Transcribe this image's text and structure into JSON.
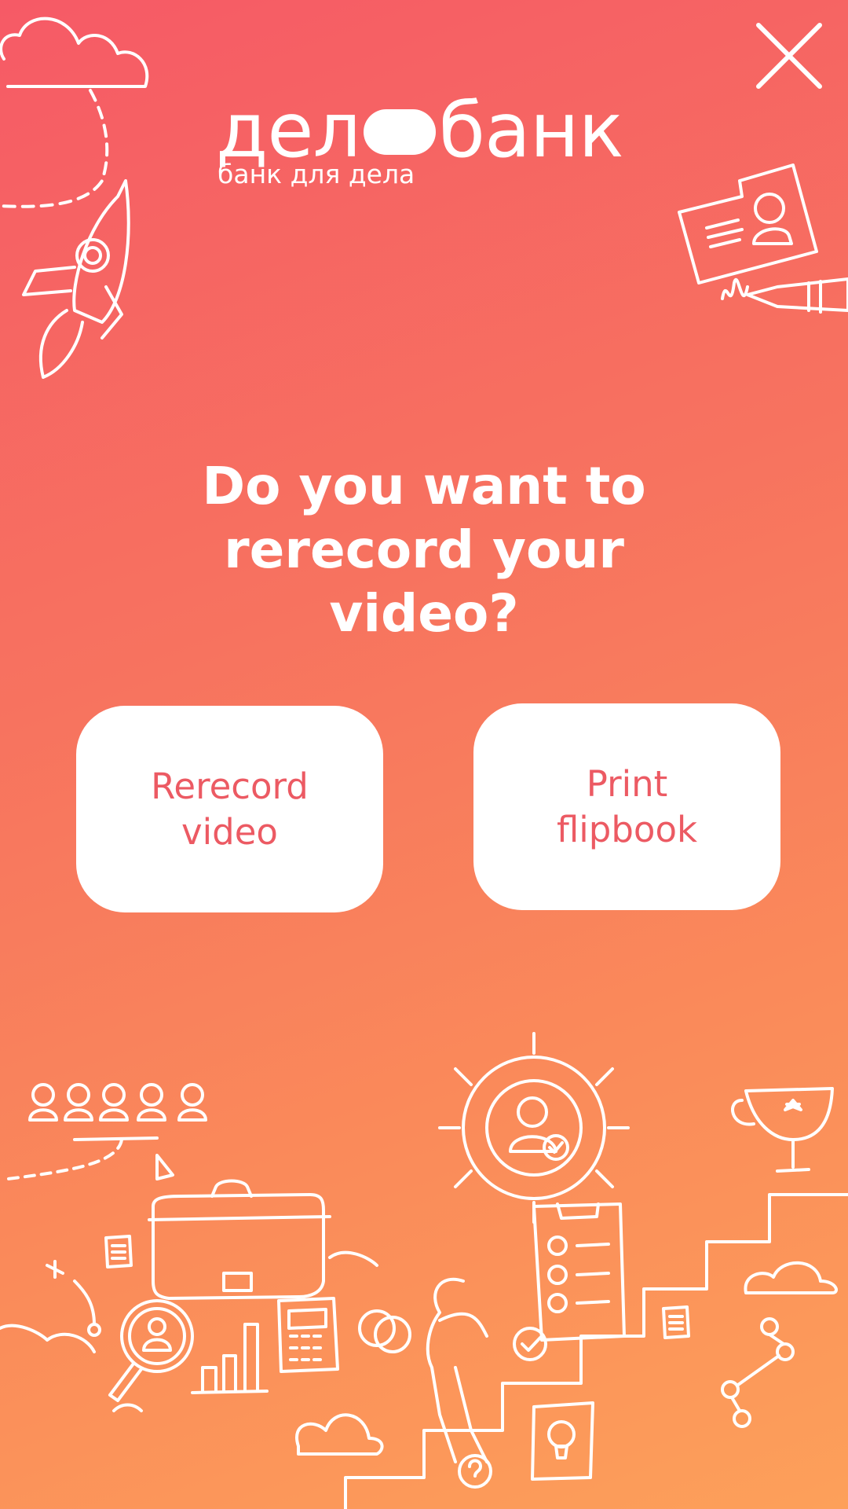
{
  "logo": {
    "word_left": "дел",
    "word_right": "банк",
    "tagline": "банк для дела"
  },
  "question": {
    "text": "Do you want to rerecord your video?"
  },
  "actions": {
    "rerecord_label": "Rerecord video",
    "print_label": "Print flipbook"
  },
  "icons": {
    "close": "close-icon",
    "rocket": "rocket-icon",
    "id_card": "id-card-icon",
    "cloud": "cloud-icon",
    "business_illustration": "business-illustration"
  },
  "colors": {
    "gradient_top": "#f65a66",
    "gradient_bottom": "#fda05a",
    "button_bg": "#ffffff",
    "button_text": "#ec5a63"
  }
}
